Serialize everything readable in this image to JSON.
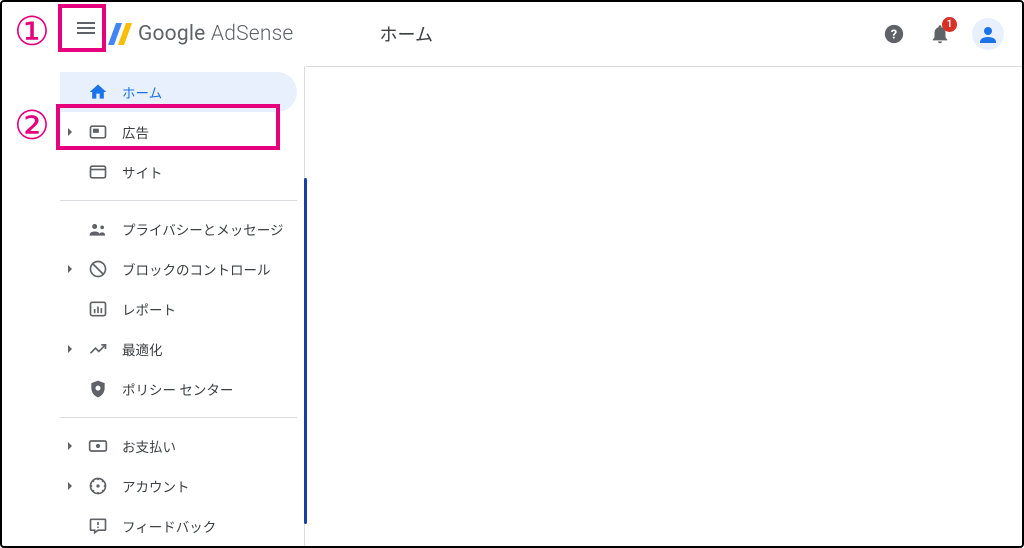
{
  "header": {
    "product_name_strong": "Google",
    "product_name_light": "AdSense",
    "page_title": "ホーム",
    "notification_count": "1"
  },
  "sidebar": {
    "items": [
      {
        "label": "ホーム",
        "icon": "home",
        "active": true,
        "expandable": false
      },
      {
        "label": "広告",
        "icon": "ad",
        "active": false,
        "expandable": true
      },
      {
        "label": "サイト",
        "icon": "site",
        "active": false,
        "expandable": false
      },
      {
        "sep": true
      },
      {
        "label": "プライバシーとメッセージ",
        "icon": "privacy",
        "active": false,
        "expandable": false
      },
      {
        "label": "ブロックのコントロール",
        "icon": "block",
        "active": false,
        "expandable": true
      },
      {
        "label": "レポート",
        "icon": "report",
        "active": false,
        "expandable": false
      },
      {
        "label": "最適化",
        "icon": "optimize",
        "active": false,
        "expandable": true
      },
      {
        "label": "ポリシー センター",
        "icon": "policy",
        "active": false,
        "expandable": false
      },
      {
        "sep": true
      },
      {
        "label": "お支払い",
        "icon": "payments",
        "active": false,
        "expandable": true
      },
      {
        "label": "アカウント",
        "icon": "account",
        "active": false,
        "expandable": true
      },
      {
        "label": "フィードバック",
        "icon": "feedback",
        "active": false,
        "expandable": false
      }
    ]
  },
  "annotations": {
    "n1": "①",
    "n2": "②"
  }
}
